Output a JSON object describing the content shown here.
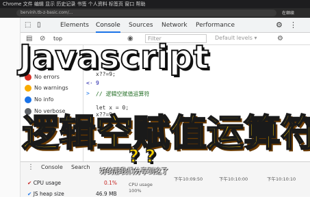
{
  "menubar": {
    "text": "Chrome  文件  编辑  显示  历史记录  书签  个人资料  标签页  窗口  帮助"
  },
  "address": {
    "url": "bervinh.tb-z-basic.com/...",
    "resume": "在继续"
  },
  "devtools": {
    "tabs": [
      "Elements",
      "Console",
      "Sources",
      "Network",
      "Performance"
    ],
    "active_tab": "Console",
    "context": "top",
    "filter_placeholder": "Filter",
    "levels_label": "Default levels ▾"
  },
  "sidebar": {
    "items": [
      {
        "label": "No errors",
        "color": "#d93025"
      },
      {
        "label": "No warnings",
        "color": "#f9ab00"
      },
      {
        "label": "No info",
        "color": "#1a73e8"
      },
      {
        "label": "No verbose",
        "color": "#5f6368"
      }
    ]
  },
  "console_lines": {
    "l1": "x??=9;",
    "l2": "9",
    "l3": "// 逻辑空赋值运算符",
    "l4": "let x = 0;",
    "l5": "x??=9;"
  },
  "overlay": {
    "title": "Javascript",
    "subtitle_cn": "逻辑空赋值运算符",
    "qq": "? ?",
    "caption": "好的那我们分享到这了"
  },
  "drawer": {
    "tabs": [
      "Console",
      "Search"
    ],
    "metrics": [
      {
        "label": "CPU usage",
        "value": "0.1%"
      },
      {
        "label": "JS heap size",
        "value": "46.9 MB"
      }
    ],
    "times": [
      "下午10:09:50",
      "下午10:10:00",
      "下午10:10:10"
    ],
    "cpu_label": "CPU usage",
    "cpu_value": "100%"
  }
}
